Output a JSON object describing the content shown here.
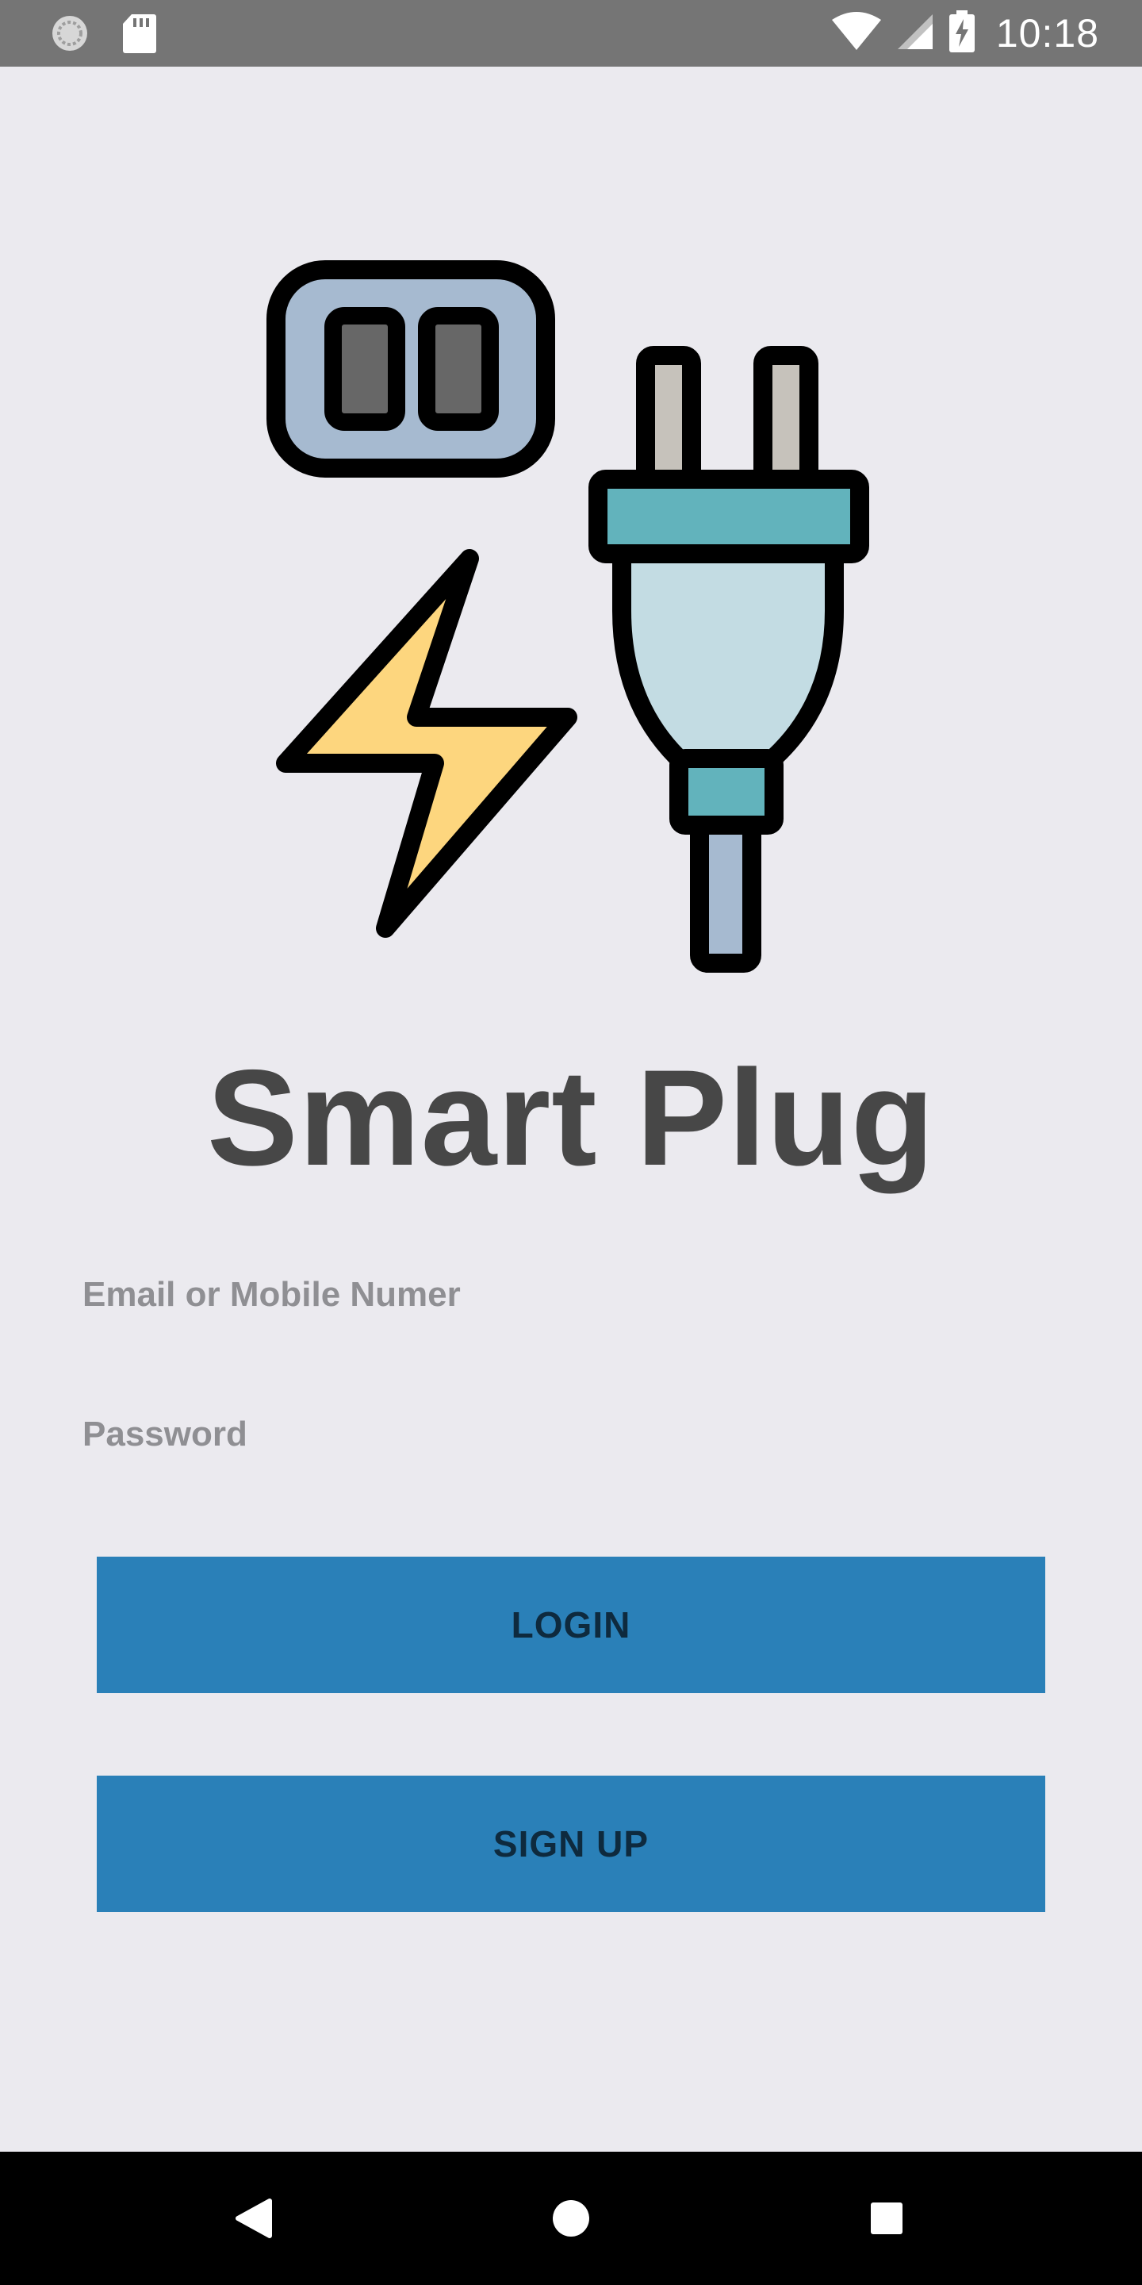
{
  "status_bar": {
    "time": "10:18",
    "icons": [
      "sync-icon",
      "sd-card-icon",
      "wifi-icon",
      "cell-signal-icon",
      "battery-charging-icon"
    ]
  },
  "hero": {
    "icons": [
      "outlet-icon",
      "lightning-bolt-icon",
      "plug-icon"
    ],
    "colors": {
      "outline": "#000000",
      "outlet_fill": "#a6bad0",
      "outlet_slots": "#676767",
      "bolt_fill": "#fdd67e",
      "plug_band": "#62b3bc",
      "plug_body": "#c3dce3",
      "prongs": "#c6c2bb",
      "cord": "#a6bad0"
    }
  },
  "app": {
    "title": "Smart Plug"
  },
  "form": {
    "email_placeholder": "Email or Mobile Numer",
    "email_value": "",
    "password_placeholder": "Password",
    "password_value": ""
  },
  "buttons": {
    "login_label": "LOGIN",
    "signup_label": "SIGN UP",
    "color": "#2a80b8"
  },
  "nav_bar": {
    "icons": [
      "back-icon",
      "home-icon",
      "recents-icon"
    ]
  }
}
